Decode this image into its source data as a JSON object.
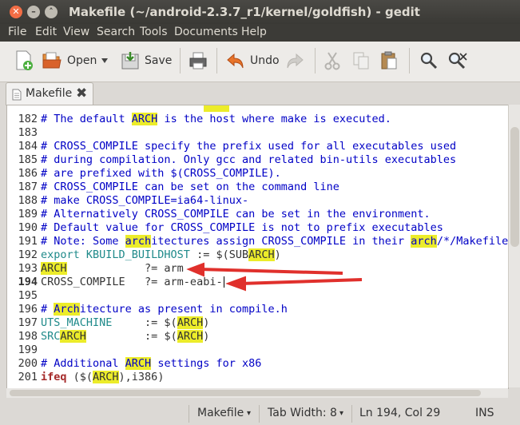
{
  "window": {
    "title": "Makefile (~/android-2.3.7_r1/kernel/goldfish) - gedit"
  },
  "menu": [
    "File",
    "Edit",
    "View",
    "Search",
    "Tools",
    "Documents",
    "Help"
  ],
  "toolbar": {
    "open": "Open",
    "save": "Save",
    "undo": "Undo"
  },
  "tab": {
    "label": "Makefile"
  },
  "editor": {
    "lines": [
      {
        "n": "182",
        "segs": [
          {
            "t": "# The default ",
            "c": "cm"
          },
          {
            "t": "ARCH",
            "c": "cm hl"
          },
          {
            "t": " is the host where make is executed.",
            "c": "cm"
          }
        ]
      },
      {
        "n": "183",
        "segs": []
      },
      {
        "n": "184",
        "segs": [
          {
            "t": "# CROSS_COMPILE specify the prefix used for all executables used",
            "c": "cm"
          }
        ]
      },
      {
        "n": "185",
        "segs": [
          {
            "t": "# during compilation. Only gcc and related bin-utils executables",
            "c": "cm"
          }
        ]
      },
      {
        "n": "186",
        "segs": [
          {
            "t": "# are prefixed with $(CROSS_COMPILE).",
            "c": "cm"
          }
        ]
      },
      {
        "n": "187",
        "segs": [
          {
            "t": "# CROSS_COMPILE can be set on the command line",
            "c": "cm"
          }
        ]
      },
      {
        "n": "188",
        "segs": [
          {
            "t": "# make CROSS_COMPILE=ia64-linux-",
            "c": "cm"
          }
        ]
      },
      {
        "n": "189",
        "segs": [
          {
            "t": "# Alternatively CROSS_COMPILE can be set in the environment.",
            "c": "cm"
          }
        ]
      },
      {
        "n": "190",
        "segs": [
          {
            "t": "# Default value for CROSS_COMPILE is not to prefix executables",
            "c": "cm"
          }
        ]
      },
      {
        "n": "191",
        "segs": [
          {
            "t": "# Note: Some ",
            "c": "cm"
          },
          {
            "t": "arch",
            "c": "cm hl"
          },
          {
            "t": "itectures assign CROSS_COMPILE in their ",
            "c": "cm"
          },
          {
            "t": "arch",
            "c": "cm hl"
          },
          {
            "t": "/*/Makefile",
            "c": "cm"
          }
        ]
      },
      {
        "n": "192",
        "segs": [
          {
            "t": "export KBUILD_BUILDHOST",
            "c": "vs"
          },
          {
            "t": " := $(SUB",
            "c": ""
          },
          {
            "t": "ARCH",
            "c": "hl"
          },
          {
            "t": ")",
            "c": ""
          }
        ]
      },
      {
        "n": "193",
        "segs": [
          {
            "t": "ARCH",
            "c": "hl"
          },
          {
            "t": "            ?= arm",
            "c": ""
          }
        ]
      },
      {
        "n": "194",
        "bold": true,
        "segs": [
          {
            "t": "CROSS_COMPILE   ?= arm-eabi-",
            "c": ""
          }
        ]
      },
      {
        "n": "195",
        "segs": []
      },
      {
        "n": "196",
        "segs": [
          {
            "t": "# ",
            "c": "cm"
          },
          {
            "t": "Arch",
            "c": "cm hl"
          },
          {
            "t": "itecture as present in compile.h",
            "c": "cm"
          }
        ]
      },
      {
        "n": "197",
        "segs": [
          {
            "t": "UTS_MACHINE",
            "c": "vs"
          },
          {
            "t": "     := $(",
            "c": ""
          },
          {
            "t": "ARCH",
            "c": "hl"
          },
          {
            "t": ")",
            "c": ""
          }
        ]
      },
      {
        "n": "198",
        "segs": [
          {
            "t": "SRC",
            "c": "vs"
          },
          {
            "t": "ARCH",
            "c": "hl"
          },
          {
            "t": "         := $(",
            "c": ""
          },
          {
            "t": "ARCH",
            "c": "hl"
          },
          {
            "t": ")",
            "c": ""
          }
        ]
      },
      {
        "n": "199",
        "segs": []
      },
      {
        "n": "200",
        "segs": [
          {
            "t": "# Additional ",
            "c": "cm"
          },
          {
            "t": "ARCH",
            "c": "cm hl"
          },
          {
            "t": " settings for x86",
            "c": "cm"
          }
        ]
      },
      {
        "n": "201",
        "segs": [
          {
            "t": "ifeq",
            "c": "kw"
          },
          {
            "t": " ($(",
            "c": ""
          },
          {
            "t": "ARCH",
            "c": "hl"
          },
          {
            "t": "),i386)",
            "c": ""
          }
        ]
      }
    ]
  },
  "status": {
    "language": "Makefile",
    "tab_width": "Tab Width:  8",
    "position": "Ln 194, Col 29",
    "mode": "INS"
  },
  "colors": {
    "comment": "#0000c6",
    "highlight": "#ecec2a",
    "variable": "#1f8a8a",
    "keyword": "#a52a2a",
    "arrow": "#e0302c"
  }
}
